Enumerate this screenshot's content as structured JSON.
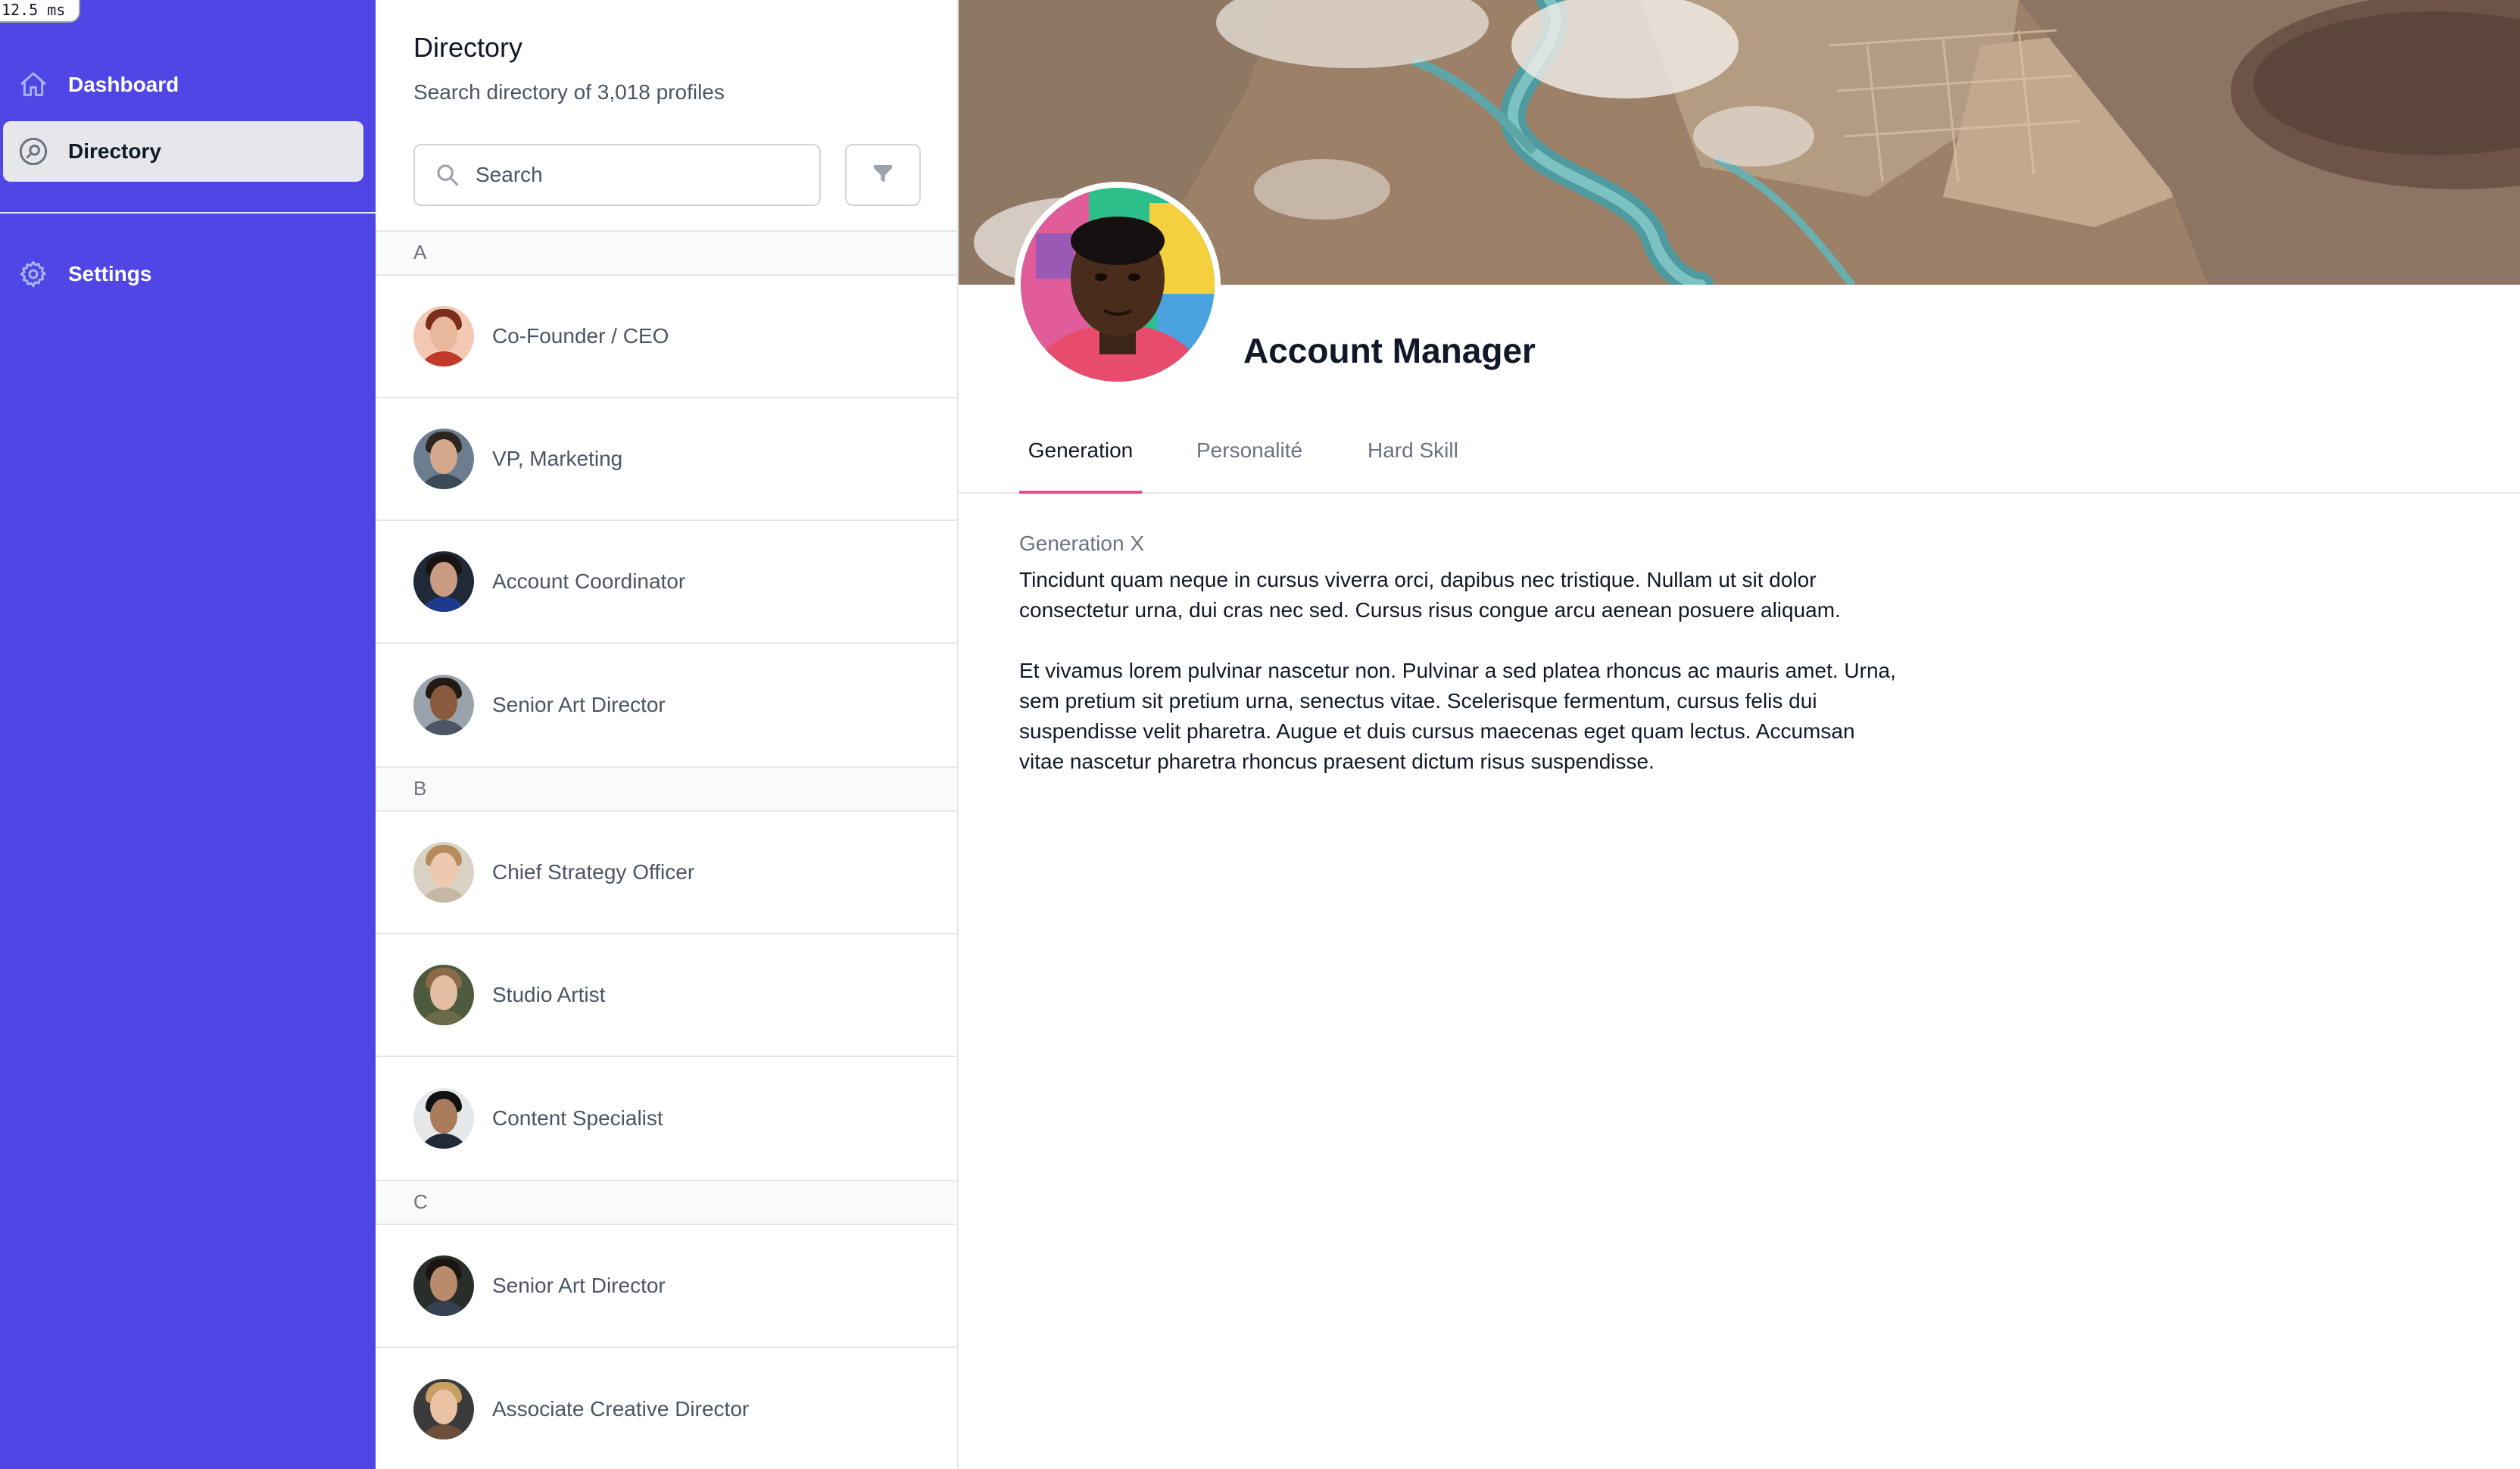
{
  "timing": "12.5 ms",
  "sidebar": {
    "items": [
      {
        "label": "Dashboard",
        "icon": "home-icon",
        "active": false
      },
      {
        "label": "Directory",
        "icon": "search-circle-icon",
        "active": true
      },
      {
        "label": "Settings",
        "icon": "gear-icon",
        "active": false
      }
    ]
  },
  "directory": {
    "title": "Directory",
    "subtitle": "Search directory of 3,018 profiles",
    "search": {
      "placeholder": "Search",
      "value": ""
    },
    "groups": [
      {
        "letter": "A",
        "people": [
          {
            "title": "Co-Founder / CEO"
          },
          {
            "title": "VP, Marketing"
          },
          {
            "title": "Account Coordinator"
          },
          {
            "title": "Senior Art Director"
          }
        ]
      },
      {
        "letter": "B",
        "people": [
          {
            "title": "Chief Strategy Officer"
          },
          {
            "title": "Studio Artist"
          },
          {
            "title": "Content Specialist"
          }
        ]
      },
      {
        "letter": "C",
        "people": [
          {
            "title": "Senior Art Director"
          },
          {
            "title": "Associate Creative Director"
          }
        ]
      }
    ]
  },
  "profile": {
    "name": "Account Manager",
    "tabs": [
      {
        "label": "Generation",
        "active": true
      },
      {
        "label": "Personalité",
        "active": false
      },
      {
        "label": "Hard Skill",
        "active": false
      }
    ],
    "detail_label": "Generation X",
    "paragraphs": [
      "Tincidunt quam neque in cursus viverra orci, dapibus nec tristique. Nullam ut sit dolor consectetur urna, dui cras nec sed. Cursus risus congue arcu aenean posuere aliquam.",
      "Et vivamus lorem pulvinar nascetur non. Pulvinar a sed platea rhoncus ac mauris amet. Urna, sem pretium sit pretium urna, senectus vitae. Scelerisque fermentum, cursus felis dui suspendisse velit pharetra. Augue et duis cursus maecenas eget quam lectus. Accumsan vitae nascetur pharetra rhoncus praesent dictum risus suspendisse."
    ]
  },
  "colors": {
    "sidebar": "#4f46e5",
    "active_tab_underline": "#ec4899",
    "active_nav_bg": "#e5e7eb"
  }
}
